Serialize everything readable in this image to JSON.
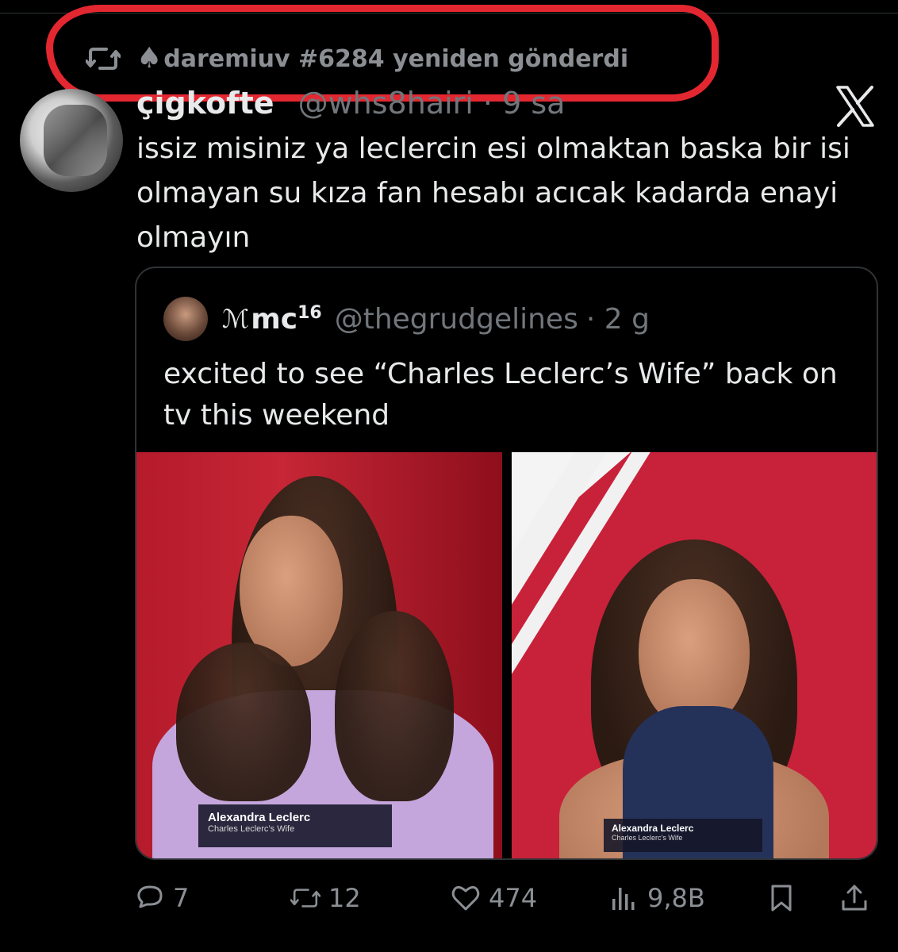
{
  "repost": {
    "icon": "repost-icon",
    "emoji": "♠",
    "label": "daremiuv #6284 yeniden gönderdi"
  },
  "tweet": {
    "author_name": "çigkofte",
    "author_handle": "@whs8hairi · 9 sa",
    "avatar": "avatar-illustrated",
    "text": "issiz misiniz ya leclercin esi olmaktan baska bir isi olmayan su kıza fan hesabı acıcak kadarda enayi olmayın",
    "brand_icon": "x-logo-icon"
  },
  "quote": {
    "mark": "ℳ",
    "name": "mc",
    "name_sup": "16",
    "handle": "@thegrudgelines",
    "time": "· 2 g",
    "text": "excited to see “Charles Leclerc’s Wife” back on tv this weekend",
    "images": [
      {
        "caption_name": "Alexandra Leclerc",
        "caption_sub": "Charles Leclerc’s Wife"
      },
      {
        "caption_name": "Alexandra Leclerc",
        "caption_sub": "Charles Leclerc’s Wife"
      }
    ]
  },
  "actions": {
    "replies": "7",
    "reposts": "12",
    "likes": "474",
    "views": "9,8B"
  },
  "colors": {
    "background": "#000000",
    "text": "#e7e9ea",
    "muted": "#71767b",
    "highlight_red": "#e32730",
    "border": "#2f3336"
  }
}
